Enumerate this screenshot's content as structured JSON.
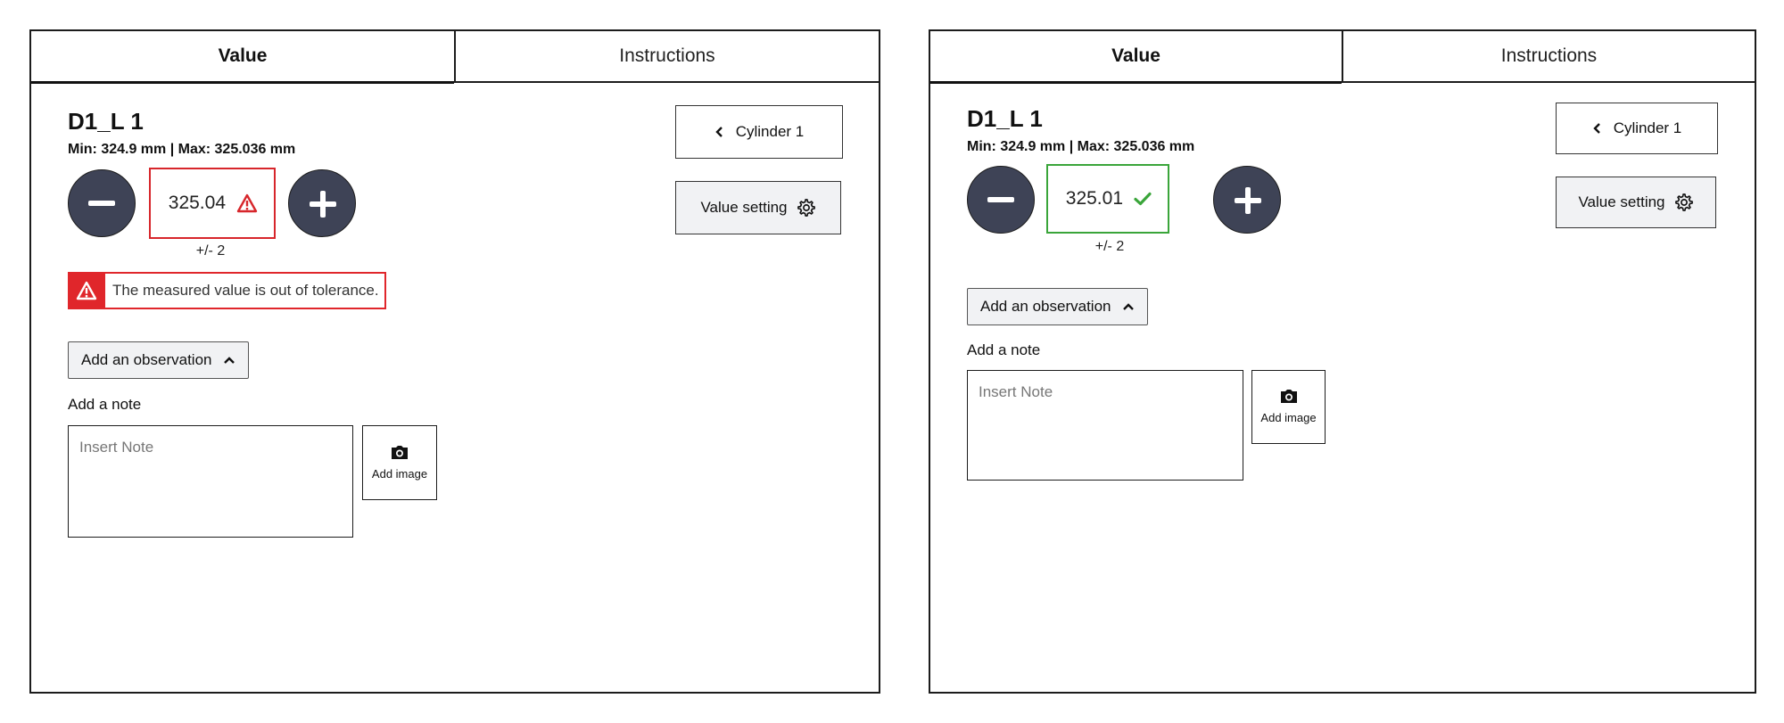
{
  "panels": [
    {
      "tabs": {
        "value": "Value",
        "instructions": "Instructions"
      },
      "title": "D1_L 1",
      "range": "Min: 324.9 mm | Max: 325.036 mm",
      "value": "325.04",
      "tolerance": "+/- 2",
      "status": "out-of-tolerance",
      "error_message": "The measured value is out of tolerance.",
      "observation_button": "Add an observation",
      "note_label": "Add a note",
      "note_placeholder": "Insert Note",
      "add_image": "Add image",
      "back_button": "Cylinder 1",
      "value_setting_button": "Value setting"
    },
    {
      "tabs": {
        "value": "Value",
        "instructions": "Instructions"
      },
      "title": "D1_L 1",
      "range": "Min: 324.9 mm | Max: 325.036 mm",
      "value": "325.01",
      "tolerance": "+/- 2",
      "status": "in-tolerance",
      "observation_button": "Add an observation",
      "note_label": "Add a note",
      "note_placeholder": "Insert Note",
      "add_image": "Add image",
      "back_button": "Cylinder 1",
      "value_setting_button": "Value setting"
    }
  ],
  "colors": {
    "error": "#e0262b",
    "success": "#3aa53a",
    "stepper_button": "#3e4356",
    "button_bg": "#f1f2f4"
  },
  "icons": [
    "minus-icon",
    "plus-icon",
    "warning-icon",
    "check-icon",
    "chevron-up-icon",
    "chevron-left-icon",
    "gear-icon",
    "camera-icon"
  ]
}
